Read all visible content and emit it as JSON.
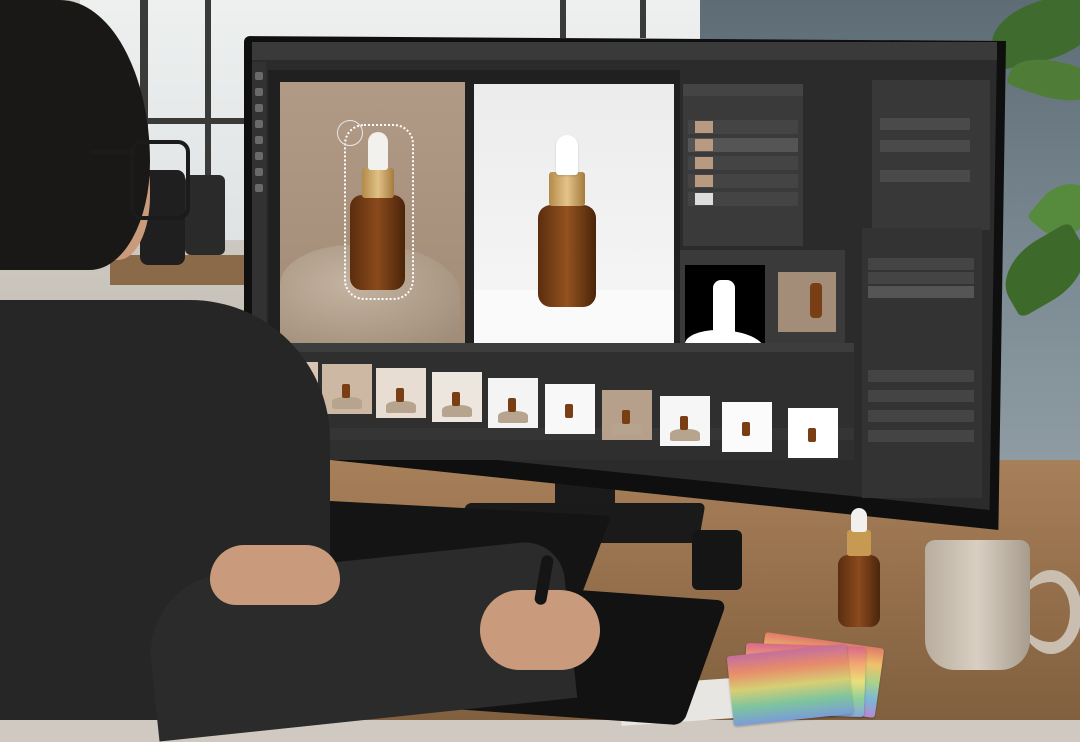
{
  "scene": {
    "description_labels": []
  },
  "editor": {
    "app": "image-editor",
    "canvas_documents": [
      {
        "name": "product-on-rock-with-selection"
      },
      {
        "name": "product-on-white"
      }
    ],
    "layers_count": 5,
    "filmstrip_thumbnails": [
      {
        "background": "#d9c5b1",
        "rock": true
      },
      {
        "background": "#cdb8a3",
        "rock": true
      },
      {
        "background": "#e8ddd2",
        "rock": true
      },
      {
        "background": "#ece6df",
        "rock": true
      },
      {
        "background": "#f4f4f4",
        "rock": true
      },
      {
        "background": "#f8f8f8",
        "rock": false
      },
      {
        "background": "#b7a08b",
        "rock": true
      },
      {
        "background": "#f6f6f6",
        "rock": true
      },
      {
        "background": "#fbfbfb",
        "rock": false
      },
      {
        "background": "#ffffff",
        "rock": false
      }
    ]
  },
  "colors": {
    "amber_bottle": "#8a4a1c",
    "gold_cap": "#c79a52",
    "ui_dark": "#2b2b2b"
  }
}
